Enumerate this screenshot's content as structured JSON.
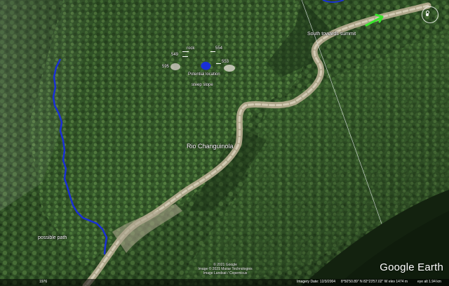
{
  "map": {
    "labels": {
      "rock": "rock",
      "pt_554": "554",
      "pt_549": "549",
      "pt_595": "595",
      "pt_553": "553",
      "potential_location": "Potential location",
      "steep_slope": "steep slope",
      "river": "Rio Changuinola",
      "possible_path": "possible path",
      "south_summit": "South towards summit"
    },
    "colors": {
      "path_blue": "#1a2fd6",
      "arrow_green": "#39e62c",
      "river_bed": "#c9bfa5"
    }
  },
  "attribution": {
    "line1": "© 2021 Google",
    "line2": "Image © 2021 Maxar Technologies",
    "line3": "Image Landsat / Copernicus"
  },
  "brand": "Google Earth",
  "status_bar": {
    "tour_badge": "1976",
    "imagery_date": "Imagery Date: 12/3/2004",
    "coordinates": "8°50'50.89\" N   82°23'57.02\" W   elev 1474 m",
    "eye_alt": "eye alt   1.94 km"
  }
}
